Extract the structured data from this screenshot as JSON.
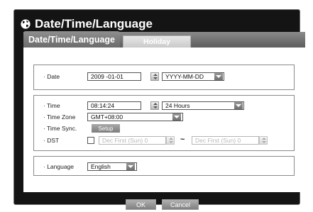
{
  "window": {
    "title": "Date/Time/Language",
    "globe_icon": "globe-icon"
  },
  "tabs": [
    {
      "label": "Date/Time/Language",
      "active": true
    },
    {
      "label": "Holiday",
      "active": false
    }
  ],
  "date_group": {
    "date_label": "· Date",
    "date_value": "2009 -01-01",
    "format_value": "YYYY-MM-DD"
  },
  "time_group": {
    "time_label": "· Time",
    "time_value": "08:14:24",
    "hour_format_value": "24 Hours",
    "timezone_label": "· Time Zone",
    "timezone_value": "GMT+08:00",
    "timesync_label": "· Time Sync.",
    "setup_button": "Setup",
    "dst_label": "· DST",
    "dst_checked": false,
    "dst_start_value": "Dec First (Sun) 0",
    "dst_separator": "~",
    "dst_end_value": "Dec First (Sun) 0"
  },
  "language_group": {
    "language_label": "· Language",
    "language_value": "English"
  },
  "footer": {
    "ok_label": "OK",
    "cancel_label": "Cancel"
  },
  "colors": {
    "dialog_bg": "#141414",
    "tab_active": "#7d7d7d",
    "button_gray": "#8f8f8f"
  }
}
